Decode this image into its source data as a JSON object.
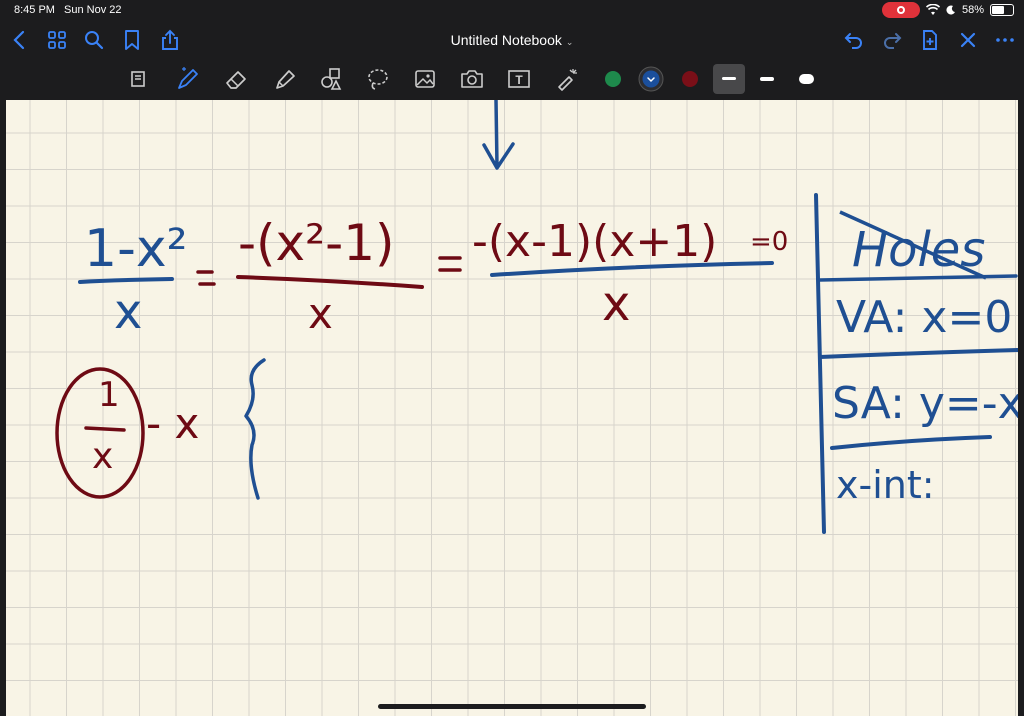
{
  "status": {
    "time": "8:45 PM",
    "date": "Sun Nov 22",
    "battery": "58%",
    "battery_level": 0.58
  },
  "nav": {
    "title": "Untitled Notebook",
    "title_chevron": "⌄"
  },
  "toolbar": {
    "tools": [
      "page-view-icon",
      "pen-icon",
      "eraser-icon",
      "highlighter-icon",
      "shapes-icon",
      "lasso-icon",
      "image-icon",
      "camera-icon",
      "text-icon",
      "laser-pointer-icon"
    ],
    "text_tool_label": "T"
  },
  "palette": {
    "green": "#1e8a4c",
    "blue": "#1b4f9c",
    "maroon": "#7a0f18"
  },
  "ink": {
    "blue": "#1f4f92",
    "maroon": "#6e0a14"
  },
  "notes": {
    "eq_left_num": "1-x²",
    "eq_left_den": "x",
    "eq_mid_num": "-(x²-1)",
    "eq_mid_den": "x",
    "eq_right_num": "-(x-1)(x+1)",
    "eq_right_tail": "=0",
    "eq_right_den": "x",
    "eq_sign_1": "=",
    "eq_sign_2": "=",
    "split_frac_num": "1",
    "split_frac_den": "x",
    "split_tail": "- x",
    "table_holes": "Holes",
    "table_va": "VA: x=0",
    "table_sa": "SA: y=-x",
    "table_xint": "x-int:"
  }
}
